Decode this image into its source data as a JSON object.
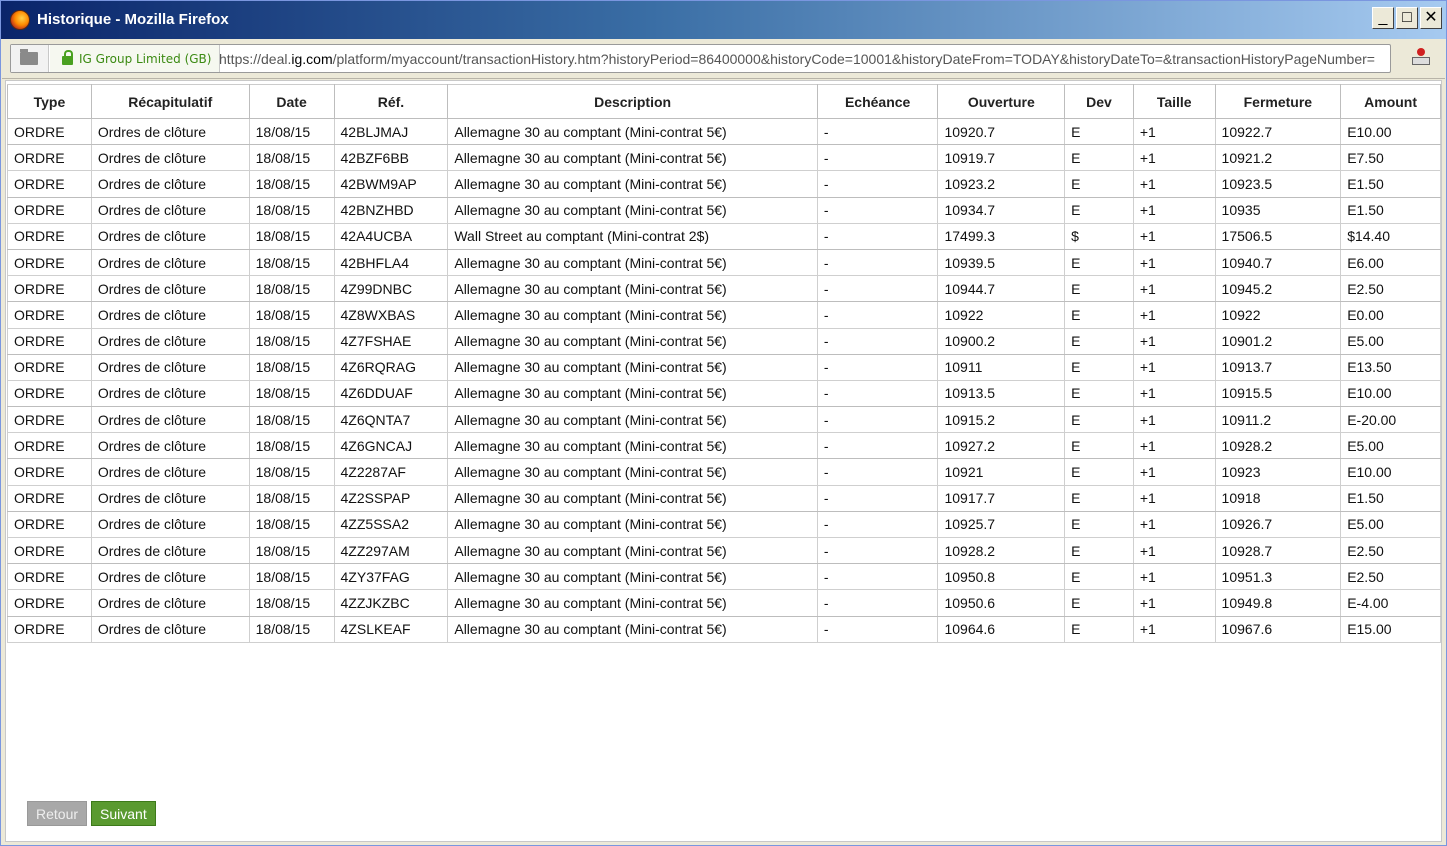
{
  "window": {
    "title": "Historique - Mozilla Firefox"
  },
  "window_controls": {
    "minimize": "_",
    "maximize": "□",
    "close": "✕"
  },
  "address_bar": {
    "identity": "IG Group Limited (GB)",
    "url_prefix": "https://deal.",
    "url_domain": "ig.com",
    "url_rest": "/platform/myaccount/transactionHistory.htm?historyPeriod=86400000&historyCode=10001&historyDateFrom=TODAY&historyDateTo=&transactionHistoryPageNumber="
  },
  "table": {
    "headers": [
      "Type",
      "Récapitulatif",
      "Date",
      "Réf.",
      "Description",
      "Echéance",
      "Ouverture",
      "Dev",
      "Taille",
      "Fermeture",
      "Amount"
    ],
    "rows": [
      [
        "ORDRE",
        "Ordres de clôture",
        "18/08/15",
        "42BLJMAJ",
        "Allemagne 30 au comptant (Mini-contrat 5€)",
        "-",
        "10920.7",
        "E",
        "+1",
        "10922.7",
        "E10.00"
      ],
      [
        "ORDRE",
        "Ordres de clôture",
        "18/08/15",
        "42BZF6BB",
        "Allemagne 30 au comptant (Mini-contrat 5€)",
        "-",
        "10919.7",
        "E",
        "+1",
        "10921.2",
        "E7.50"
      ],
      [
        "ORDRE",
        "Ordres de clôture",
        "18/08/15",
        "42BWM9AP",
        "Allemagne 30 au comptant (Mini-contrat 5€)",
        "-",
        "10923.2",
        "E",
        "+1",
        "10923.5",
        "E1.50"
      ],
      [
        "ORDRE",
        "Ordres de clôture",
        "18/08/15",
        "42BNZHBD",
        "Allemagne 30 au comptant (Mini-contrat 5€)",
        "-",
        "10934.7",
        "E",
        "+1",
        "10935",
        "E1.50"
      ],
      [
        "ORDRE",
        "Ordres de clôture",
        "18/08/15",
        "42A4UCBA",
        "Wall Street au comptant (Mini-contrat 2$)",
        "-",
        "17499.3",
        "$",
        "+1",
        "17506.5",
        "$14.40"
      ],
      [
        "ORDRE",
        "Ordres de clôture",
        "18/08/15",
        "42BHFLA4",
        "Allemagne 30 au comptant (Mini-contrat 5€)",
        "-",
        "10939.5",
        "E",
        "+1",
        "10940.7",
        "E6.00"
      ],
      [
        "ORDRE",
        "Ordres de clôture",
        "18/08/15",
        "4Z99DNBC",
        "Allemagne 30 au comptant (Mini-contrat 5€)",
        "-",
        "10944.7",
        "E",
        "+1",
        "10945.2",
        "E2.50"
      ],
      [
        "ORDRE",
        "Ordres de clôture",
        "18/08/15",
        "4Z8WXBAS",
        "Allemagne 30 au comptant (Mini-contrat 5€)",
        "-",
        "10922",
        "E",
        "+1",
        "10922",
        "E0.00"
      ],
      [
        "ORDRE",
        "Ordres de clôture",
        "18/08/15",
        "4Z7FSHAE",
        "Allemagne 30 au comptant (Mini-contrat 5€)",
        "-",
        "10900.2",
        "E",
        "+1",
        "10901.2",
        "E5.00"
      ],
      [
        "ORDRE",
        "Ordres de clôture",
        "18/08/15",
        "4Z6RQRAG",
        "Allemagne 30 au comptant (Mini-contrat 5€)",
        "-",
        "10911",
        "E",
        "+1",
        "10913.7",
        "E13.50"
      ],
      [
        "ORDRE",
        "Ordres de clôture",
        "18/08/15",
        "4Z6DDUAF",
        "Allemagne 30 au comptant (Mini-contrat 5€)",
        "-",
        "10913.5",
        "E",
        "+1",
        "10915.5",
        "E10.00"
      ],
      [
        "ORDRE",
        "Ordres de clôture",
        "18/08/15",
        "4Z6QNTA7",
        "Allemagne 30 au comptant (Mini-contrat 5€)",
        "-",
        "10915.2",
        "E",
        "+1",
        "10911.2",
        "E-20.00"
      ],
      [
        "ORDRE",
        "Ordres de clôture",
        "18/08/15",
        "4Z6GNCAJ",
        "Allemagne 30 au comptant (Mini-contrat 5€)",
        "-",
        "10927.2",
        "E",
        "+1",
        "10928.2",
        "E5.00"
      ],
      [
        "ORDRE",
        "Ordres de clôture",
        "18/08/15",
        "4Z2287AF",
        "Allemagne 30 au comptant (Mini-contrat 5€)",
        "-",
        "10921",
        "E",
        "+1",
        "10923",
        "E10.00"
      ],
      [
        "ORDRE",
        "Ordres de clôture",
        "18/08/15",
        "4Z2SSPAP",
        "Allemagne 30 au comptant (Mini-contrat 5€)",
        "-",
        "10917.7",
        "E",
        "+1",
        "10918",
        "E1.50"
      ],
      [
        "ORDRE",
        "Ordres de clôture",
        "18/08/15",
        "4ZZ5SSA2",
        "Allemagne 30 au comptant (Mini-contrat 5€)",
        "-",
        "10925.7",
        "E",
        "+1",
        "10926.7",
        "E5.00"
      ],
      [
        "ORDRE",
        "Ordres de clôture",
        "18/08/15",
        "4ZZ297AM",
        "Allemagne 30 au comptant (Mini-contrat 5€)",
        "-",
        "10928.2",
        "E",
        "+1",
        "10928.7",
        "E2.50"
      ],
      [
        "ORDRE",
        "Ordres de clôture",
        "18/08/15",
        "4ZY37FAG",
        "Allemagne 30 au comptant (Mini-contrat 5€)",
        "-",
        "10950.8",
        "E",
        "+1",
        "10951.3",
        "E2.50"
      ],
      [
        "ORDRE",
        "Ordres de clôture",
        "18/08/15",
        "4ZZJKZBC",
        "Allemagne 30 au comptant (Mini-contrat 5€)",
        "-",
        "10950.6",
        "E",
        "+1",
        "10949.8",
        "E-4.00"
      ],
      [
        "ORDRE",
        "Ordres de clôture",
        "18/08/15",
        "4ZSLKEAF",
        "Allemagne 30 au comptant (Mini-contrat 5€)",
        "-",
        "10964.6",
        "E",
        "+1",
        "10967.6",
        "E15.00"
      ]
    ]
  },
  "pagination": {
    "prev_label": "Retour",
    "next_label": "Suivant"
  },
  "icons": {
    "app": "firefox-icon",
    "page": "page-icon",
    "lock": "lock-icon",
    "side": "notification-icon"
  },
  "colors": {
    "identity": "#3b8a12",
    "next_button": "#5a9a30",
    "prev_button": "#a8a8a8"
  }
}
